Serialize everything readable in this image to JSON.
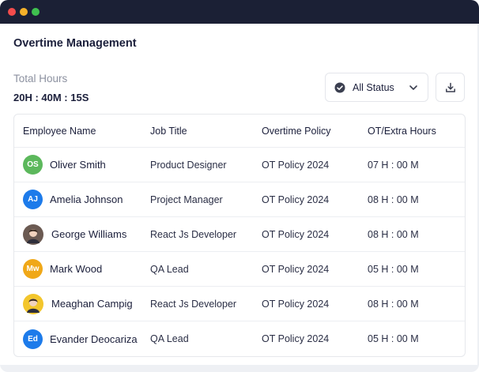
{
  "window": {
    "controls": [
      "close",
      "minimize",
      "maximize"
    ]
  },
  "page": {
    "title": "Overtime Management",
    "total_label": "Total Hours",
    "total_value": "20H : 40M : 15S"
  },
  "toolbar": {
    "status_filter": "All Status",
    "check_icon": "check-circle-icon",
    "chevron_icon": "chevron-down-icon",
    "download_icon": "download-icon"
  },
  "table": {
    "columns": [
      "Employee Name",
      "Job Title",
      "Overtime Policy",
      "OT/Extra Hours"
    ],
    "rows": [
      {
        "initials": "OS",
        "avatar_color": "#5cb85c",
        "photo": false,
        "name": "Oliver Smith",
        "job": "Product Designer",
        "policy": "OT Policy 2024",
        "hours": "07 H : 00 M"
      },
      {
        "initials": "AJ",
        "avatar_color": "#1d7bea",
        "photo": false,
        "name": "Amelia Johnson",
        "job": "Project Manager",
        "policy": "OT Policy 2024",
        "hours": "08 H : 00 M"
      },
      {
        "initials": "",
        "avatar_color": "#6b5a52",
        "photo": true,
        "name": "George Williams",
        "job": "React Js Developer",
        "policy": "OT Policy 2024",
        "hours": "08 H : 00 M"
      },
      {
        "initials": "Mw",
        "avatar_color": "#f0a818",
        "photo": false,
        "name": "Mark Wood",
        "job": "QA Lead",
        "policy": "OT Policy 2024",
        "hours": "05 H : 00 M"
      },
      {
        "initials": "",
        "avatar_color": "#f3c62c",
        "photo": true,
        "name": "Meaghan Campig",
        "job": "React Js Developer",
        "policy": "OT Policy 2024",
        "hours": "08 H : 00 M"
      },
      {
        "initials": "Ed",
        "avatar_color": "#1d7bea",
        "photo": false,
        "name": "Evander Deocariza",
        "job": "QA Lead",
        "policy": "OT Policy 2024",
        "hours": "05 H : 00 M"
      }
    ]
  }
}
